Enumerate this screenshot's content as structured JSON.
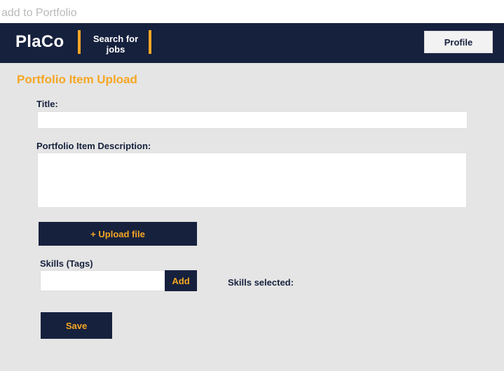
{
  "frame": {
    "title": "add to Portfolio"
  },
  "navbar": {
    "logo": "PlaCo",
    "link_search": "Search for jobs",
    "profile_label": "Profile"
  },
  "form": {
    "heading": "Portfolio Item Upload",
    "title_label": "Title:",
    "title_value": "",
    "description_label": "Portfolio Item Description:",
    "description_value": "",
    "upload_label": "+ Upload file",
    "skills_label": "Skills (Tags)",
    "skills_value": "",
    "add_label": "Add",
    "skills_selected_label": "Skills selected:",
    "save_label": "Save"
  },
  "colors": {
    "navbar": "#16213d",
    "accent": "#f5a623",
    "content_bg": "#e5e5e5"
  }
}
